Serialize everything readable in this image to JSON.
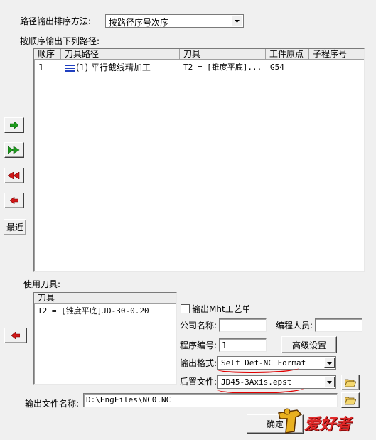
{
  "sort": {
    "label": "路径输出排序方法:",
    "selected": "按路径序号次序"
  },
  "order_label": "按顺序输出下列路径:",
  "path_table": {
    "headers": [
      "顺序",
      "刀具路径",
      "刀具",
      "工件原点",
      "子程序号"
    ],
    "rows": [
      {
        "order": "1",
        "path": "(1) 平行截线精加工",
        "tool": "T2 = [锥度平底]...",
        "origin": "G54",
        "sub": ""
      }
    ]
  },
  "side_buttons": {
    "recent_label": "最近"
  },
  "used_tools": {
    "label": "使用刀具:",
    "header": "刀具",
    "rows": [
      "T2 = [锥度平底]JD-30-0.20"
    ]
  },
  "options": {
    "mht_label": "输出Mht工艺单",
    "mht_checked": false,
    "company_label": "公司名称:",
    "company_value": "",
    "programmer_label": "编程人员:",
    "programmer_value": "",
    "program_no_label": "程序编号:",
    "program_no_value": "1",
    "advanced_label": "高级设置",
    "format_label": "输出格式:",
    "format_value": "Self_Def-NC Format",
    "post_label": "后置文件:",
    "post_value": "JD45-3Axis.epst"
  },
  "output": {
    "label": "输出文件名称:",
    "value": "D:\\EngFiles\\NC0.NC"
  },
  "ok_label": "确定",
  "watermark": "爱好者",
  "colors": {
    "green_arrow": "#1c9a1c",
    "red_arrow": "#d01818",
    "underline": "#e00000"
  }
}
